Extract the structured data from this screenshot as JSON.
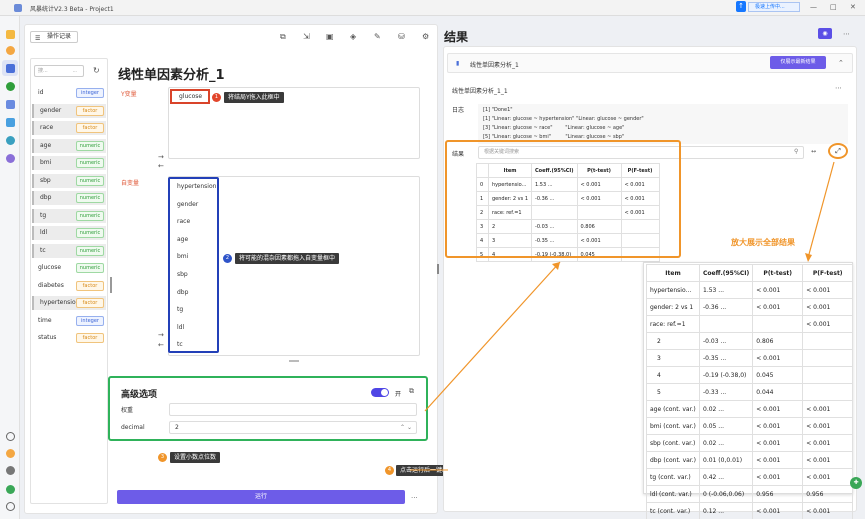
{
  "app": {
    "title": "风暴统计V2.3 Beta - Project1",
    "update_label": "极速上传中..."
  },
  "toolbar": {
    "op_record_label": "操作记录"
  },
  "analysis": {
    "title": "线性单因素分析_1",
    "y_label": "Y变量",
    "x_label": "自变量",
    "y_var": "glucose",
    "x_vars": [
      "hypertension",
      "gender",
      "race",
      "age",
      "bmi",
      "sbp",
      "dbp",
      "tg",
      "ldl",
      "tc"
    ]
  },
  "variables": {
    "search_placeholder": "搜...",
    "filter_label": "...",
    "items": [
      {
        "name": "id",
        "type": "integer",
        "selected": false
      },
      {
        "name": "gender",
        "type": "factor",
        "selected": true
      },
      {
        "name": "race",
        "type": "factor",
        "selected": true
      },
      {
        "name": "age",
        "type": "numeric",
        "selected": true
      },
      {
        "name": "bmi",
        "type": "numeric",
        "selected": true
      },
      {
        "name": "sbp",
        "type": "numeric",
        "selected": true
      },
      {
        "name": "dbp",
        "type": "numeric",
        "selected": true
      },
      {
        "name": "tg",
        "type": "numeric",
        "selected": true
      },
      {
        "name": "ldl",
        "type": "numeric",
        "selected": true
      },
      {
        "name": "tc",
        "type": "numeric",
        "selected": true
      },
      {
        "name": "glucose",
        "type": "numeric",
        "selected": false
      },
      {
        "name": "diabetes",
        "type": "factor",
        "selected": false
      },
      {
        "name": "hypertension",
        "type": "factor",
        "selected": true
      },
      {
        "name": "time",
        "type": "integer",
        "selected": false
      },
      {
        "name": "status",
        "type": "factor",
        "selected": false
      }
    ]
  },
  "annotations": {
    "a1": {
      "num": "1",
      "text": "将结局Y拖入此框中",
      "color": "#e2452b"
    },
    "a2": {
      "num": "2",
      "text": "将可能的混杂因素都拖入自变量框中",
      "color": "#2f54c9"
    },
    "a3": {
      "num": "3",
      "text": "设置小数点位数",
      "color": "#f0952a"
    },
    "a4": {
      "num": "4",
      "text": "点击运行后一键出结果",
      "color": "#f0952a"
    },
    "expand_caption": "放大展示全部结果"
  },
  "advanced": {
    "title": "高级选项",
    "toggle_label": "开",
    "weight_label": "权重",
    "weight_value": "",
    "decimal_label": "decimal",
    "decimal_value": "2"
  },
  "run": {
    "label": "运行",
    "more": "..."
  },
  "results": {
    "title": "结果",
    "tab_label": "线性单因素分析_1",
    "only_show_label": "仅展示最新结果",
    "subtitle": "线性单因素分析_1_1",
    "log_label": "日志",
    "log_lines": [
      "[1] \"Done1\"",
      "[1] \"Linear: glucose ~ hypertension\" \"Linear: glucose ~ gender\"",
      "[3] \"Linear: glucose ~ race\"        \"Linear: glucose ~ age\"",
      "[5] \"Linear: glucose ~ bmi\"         \"Linear: glucose ~ sbp\""
    ],
    "table_label": "结果",
    "search_placeholder": "根据关键词搜索",
    "columns": [
      "Item",
      "Coeff.(95%CI)",
      "P(t-test)",
      "P(F-test)"
    ],
    "small_rows": [
      [
        "0",
        "hypertensio...",
        "1.53 ...",
        "< 0.001",
        "< 0.001"
      ],
      [
        "1",
        "gender: 2 vs 1",
        "-0.36 ...",
        "< 0.001",
        "< 0.001"
      ],
      [
        "2",
        "race: ref.=1",
        "",
        "",
        "< 0.001"
      ],
      [
        "3",
        "2",
        "-0.03 ...",
        "0.806",
        ""
      ],
      [
        "4",
        "3",
        "-0.35 ...",
        "< 0.001",
        ""
      ],
      [
        "5",
        "4",
        "-0.19 (-0.38,0)",
        "0.045",
        ""
      ]
    ],
    "big_rows": [
      [
        "hypertensio...",
        "1.53 ...",
        "< 0.001",
        "< 0.001"
      ],
      [
        "gender: 2 vs 1",
        "-0.36 ...",
        "< 0.001",
        "< 0.001"
      ],
      [
        "race: ref.=1",
        "",
        "",
        "< 0.001"
      ],
      [
        "2",
        "-0.03 ...",
        "0.806",
        ""
      ],
      [
        "3",
        "-0.35 ...",
        "< 0.001",
        ""
      ],
      [
        "4",
        "-0.19 (-0.38,0)",
        "0.045",
        ""
      ],
      [
        "5",
        "-0.33 ...",
        "0.044",
        ""
      ],
      [
        "age (cont. var.)",
        "0.02 ...",
        "< 0.001",
        "< 0.001"
      ],
      [
        "bmi (cont. var.)",
        "0.05 ...",
        "< 0.001",
        "< 0.001"
      ],
      [
        "sbp (cont. var.)",
        "0.02 ...",
        "< 0.001",
        "< 0.001"
      ],
      [
        "dbp (cont. var.)",
        "0.01 (0,0.01)",
        "< 0.001",
        "< 0.001"
      ],
      [
        "tg (cont. var.)",
        "0.42 ...",
        "< 0.001",
        "< 0.001"
      ],
      [
        "ldl (cont. var.)",
        "0 (-0.06,0.06)",
        "0.956",
        "0.956"
      ],
      [
        "tc (cont. var.)",
        "0.12 ...",
        "< 0.001",
        "< 0.001"
      ]
    ]
  },
  "colors": {
    "accent": "#6d5ce8",
    "annot_orange": "#f0952a",
    "annot_green": "#2fb25a",
    "annot_blue": "#2340b8",
    "annot_red": "#d9442a"
  }
}
